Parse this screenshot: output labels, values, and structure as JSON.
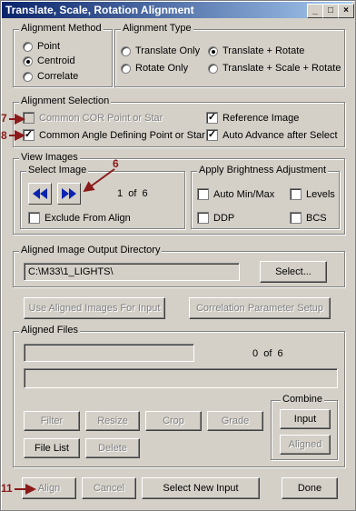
{
  "window": {
    "title": "Translate, Scale, Rotation Alignment",
    "buttons": [
      "_",
      "□",
      "×"
    ]
  },
  "alignment_method": {
    "label": "Alignment Method",
    "options": [
      {
        "label": "Point",
        "selected": false
      },
      {
        "label": "Centroid",
        "selected": true
      },
      {
        "label": "Correlate",
        "selected": false
      }
    ]
  },
  "alignment_type": {
    "label": "Alignment Type",
    "options": [
      {
        "label": "Translate Only",
        "selected": false
      },
      {
        "label": "Translate + Rotate",
        "selected": true
      },
      {
        "label": "Rotate Only",
        "selected": false
      },
      {
        "label": "Translate + Scale + Rotate",
        "selected": false
      }
    ]
  },
  "alignment_selection": {
    "label": "Alignment Selection",
    "common_cor": {
      "label": "Common COR Point or Star",
      "checked": false,
      "enabled": false
    },
    "common_angle": {
      "label": "Common Angle Defining Point or Star",
      "checked": true
    },
    "reference_image": {
      "label": "Reference Image",
      "checked": true
    },
    "auto_advance": {
      "label": "Auto Advance after Select",
      "checked": true
    }
  },
  "view_images": {
    "label": "View Images",
    "select_image": {
      "label": "Select Image",
      "counter": "1  of  6",
      "exclude": {
        "label": "Exclude From Align",
        "checked": false
      }
    },
    "brightness": {
      "label": "Apply Brightness Adjustment",
      "auto_minmax": {
        "label": "Auto Min/Max",
        "checked": false
      },
      "levels": {
        "label": "Levels",
        "checked": false
      },
      "ddp": {
        "label": "DDP",
        "checked": false
      },
      "bcs": {
        "label": "BCS",
        "checked": false
      }
    }
  },
  "output_dir": {
    "label": "Aligned Image Output Directory",
    "value": "C:\\M33\\1_LIGHTS\\",
    "select_button": "Select..."
  },
  "buttons_row": {
    "use_aligned": "Use Aligned Images For Input",
    "correlation_setup": "Correlation Parameter Setup"
  },
  "aligned_files": {
    "label": "Aligned Files",
    "counter": "0  of  6",
    "filter": "Filter",
    "resize": "Resize",
    "crop": "Crop",
    "grade": "Grade",
    "file_list": "File List",
    "delete": "Delete",
    "combine": {
      "label": "Combine",
      "input": "Input",
      "aligned": "Aligned"
    }
  },
  "bottom": {
    "align": "Align",
    "cancel": "Cancel",
    "select_new_input": "Select New Input",
    "done": "Done"
  },
  "annotations": {
    "a7": "7",
    "a8": "8",
    "a6": "6",
    "a11": "11"
  },
  "colors": {
    "title_start": "#0a246a",
    "title_end": "#a6caf0",
    "annotation": "#8b1a1a"
  }
}
